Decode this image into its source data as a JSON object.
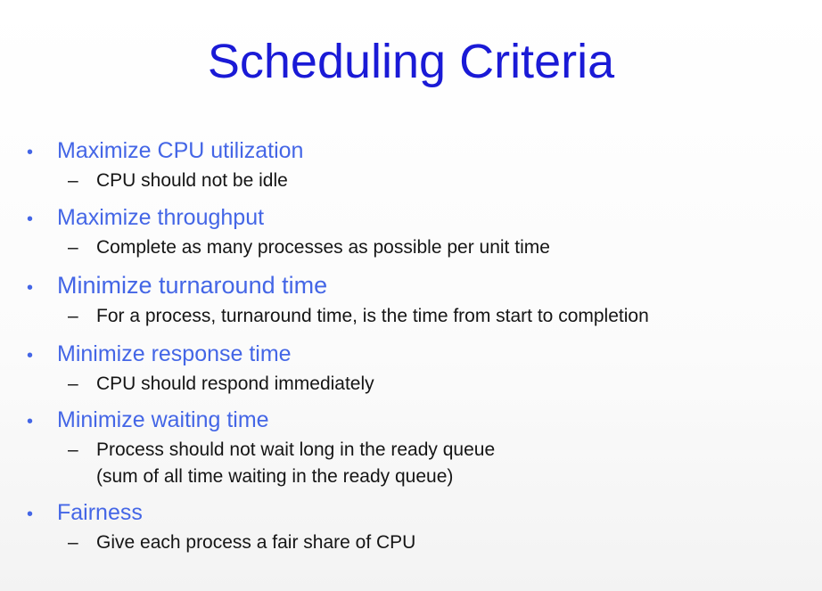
{
  "slide": {
    "title": "Scheduling Criteria",
    "bullet_glyph": "•",
    "dash_glyph": "–",
    "items": [
      {
        "label": "Maximize CPU utilization",
        "sub": [
          "CPU should not be idle"
        ]
      },
      {
        "label": "Maximize throughput",
        "sub": [
          "Complete as many processes as possible per unit time"
        ]
      },
      {
        "label": "Minimize turnaround time",
        "sub": [
          "For a process, turnaround time, is the time from start to completion"
        ]
      },
      {
        "label": "Minimize response time",
        "sub": [
          "CPU should respond immediately"
        ]
      },
      {
        "label": "Minimize waiting time",
        "sub": [
          "Process should not wait long in the ready queue",
          "(sum of all time waiting in the ready queue)"
        ]
      },
      {
        "label": "Fairness",
        "sub": [
          "Give each process a fair share of CPU"
        ]
      }
    ],
    "colors": {
      "title": "#1a1ad6",
      "bullet": "#4466e6",
      "body": "#151515"
    }
  }
}
